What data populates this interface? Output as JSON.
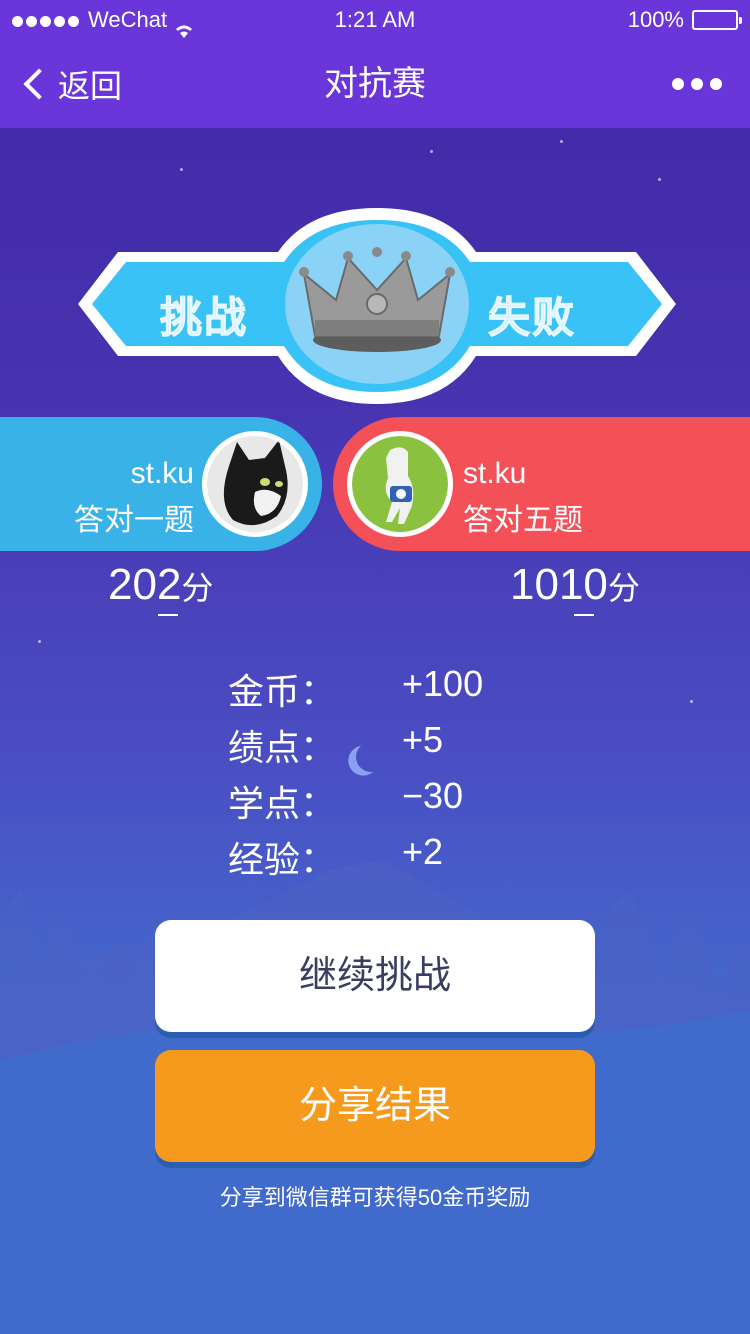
{
  "status_bar": {
    "carrier": "WeChat",
    "time": "1:21 AM",
    "battery": "100%"
  },
  "nav": {
    "back_label": "返回",
    "title": "对抗赛"
  },
  "banner": {
    "left_text": "挑战",
    "right_text": "失败"
  },
  "players": [
    {
      "name": "st.ku",
      "stat": "答对一题",
      "score": "202",
      "unit": "分",
      "side_color": "#39b2e8"
    },
    {
      "name": "st.ku",
      "stat": "答对五题",
      "score": "1010",
      "unit": "分",
      "side_color": "#f35057"
    }
  ],
  "rewards": [
    {
      "label": "金币：",
      "value": "+100"
    },
    {
      "label": "绩点：",
      "value": "+5"
    },
    {
      "label": "学点：",
      "value": "−30"
    },
    {
      "label": "经验：",
      "value": "+2"
    }
  ],
  "actions": {
    "continue_label": "继续挑战",
    "share_label": "分享结果",
    "share_hint": "分享到微信群可获得50金币奖励"
  },
  "colors": {
    "header": "#6a35d9",
    "share_button": "#f59a1d"
  }
}
